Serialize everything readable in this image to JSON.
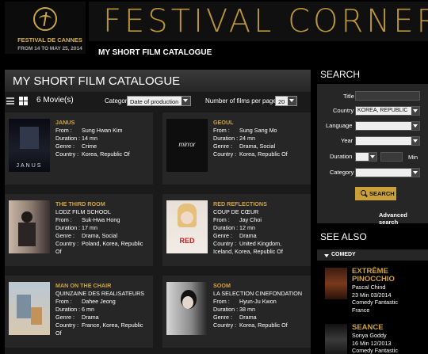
{
  "header": {
    "logo_title": "FESTIVAL DE CANNES",
    "logo_dates": "FROM 14 TO MAY 25, 2014",
    "brand": "FESTIVAL CORNER",
    "subtitle": "MY SHORT FILM CATALOGUE"
  },
  "main": {
    "title": "MY SHORT FILM CATALOGUE",
    "count": "6 Movie(s)",
    "categorised_label": "Categorised by:",
    "categorised_value": "Date of production",
    "perpage_label": "Number of films per page",
    "perpage_value": "20",
    "labels": {
      "from": "From :",
      "duration": "Duration :",
      "genre": "Genre :",
      "country": "Country :"
    },
    "films": [
      {
        "title": "JANUS",
        "school": "",
        "from": "Sung Hwan Kim",
        "duration": "14 mn",
        "genre": "Crime",
        "country": "Korea, Republic Of",
        "country2": "",
        "poster_text": "JANUS"
      },
      {
        "title": "GEOUL",
        "school": "",
        "from": "Sung Sang Mo",
        "duration": "24 mn",
        "genre": "Drama, Social",
        "country": "Korea, Republic Of",
        "country2": "",
        "poster_text": "mirror"
      },
      {
        "title": "THE THIRD ROOM",
        "school": "LODZ FILM SCHOOL",
        "from": "Suk-Hwa Hong",
        "duration": "17 mn",
        "genre": "Drama, Social",
        "country": "Poland, Korea, Republic",
        "country2": "Of",
        "poster_text": ""
      },
      {
        "title": "RED REFLECTIONS",
        "school": "COUP DE CŒUR",
        "from": "Jay Choi",
        "duration": "12 mn",
        "genre": "Drama",
        "country": "United Kingdom,",
        "country2": "Iceland, Korea, Republic Of",
        "poster_text": "RED"
      },
      {
        "title": "MAN ON THE CHAIR",
        "school": "QUINZAINE DES REALISATEURS",
        "from": "Dahee Jeong",
        "duration": "6 mn",
        "genre": "Drama",
        "country": "France, Korea, Republic",
        "country2": "Of",
        "poster_text": ""
      },
      {
        "title": "SOOM",
        "school": "LA SELECTION CINEFONDATION",
        "from": "Hyun-Ju Kwon",
        "duration": "38 mn",
        "genre": "Drama",
        "country": "Korea, Republic Of",
        "country2": "",
        "poster_text": ""
      }
    ]
  },
  "search": {
    "heading": "SEARCH",
    "title_label": "Title",
    "country_label": "Country",
    "country_value": "KOREA, REPUBLIC",
    "language_label": "Language",
    "year_label": "Year",
    "duration_label": "Duration",
    "duration_unit": "Min",
    "category_label": "Category",
    "button_label": "SEARCH",
    "advanced_label": "Advanced search"
  },
  "see_also": {
    "heading": "SEE ALSO",
    "category": "COMEDY",
    "items": [
      {
        "title1": "EXTRÊME",
        "title2": "PINOCCHIO",
        "line1": "Pascal Chind",
        "line2": "23 Min 03/2014",
        "line3": "Comedy Fantastic",
        "line4": "France"
      },
      {
        "title1": "SEANCE",
        "title2": "",
        "line1": "Sonya Goddy",
        "line2": "16 Min 12/2013",
        "line3": "Comedy Fantastic",
        "line4": ""
      }
    ]
  }
}
